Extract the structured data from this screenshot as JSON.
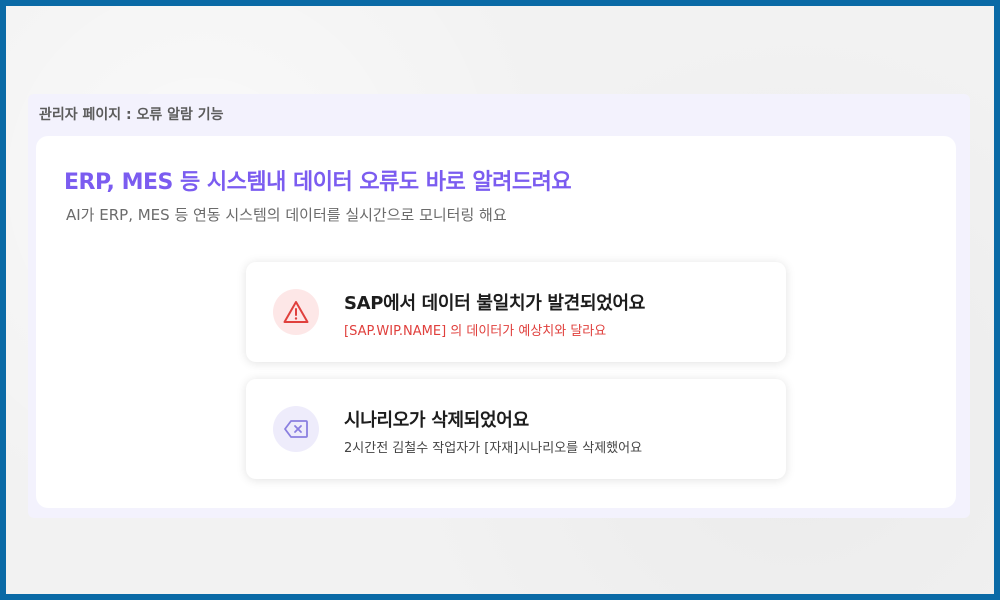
{
  "panel": {
    "title": "관리자 페이지 : 오류 알람 기능"
  },
  "card": {
    "headline": "ERP, MES 등 시스템내 데이터 오류도 바로 알려드려요",
    "subline": "AI가 ERP, MES 등 연동 시스템의 데이터를 실시간으로 모니터링 해요"
  },
  "alerts": [
    {
      "icon": "warning-triangle-icon",
      "title": "SAP에서 데이터 불일치가 발견되었어요",
      "description": "[SAP.WIP.NAME] 의 데이터가 예상치와 달라요",
      "accent_color": "#e0403d",
      "icon_bg": "#fde7e7"
    },
    {
      "icon": "backspace-delete-icon",
      "title": "시나리오가 삭제되었어요",
      "description": "2시간전 김철수 작업자가 [자재]시나리오를 삭제했어요",
      "accent_color": "#8a7fe0",
      "icon_bg": "#eeecfb"
    }
  ],
  "colors": {
    "frame_border": "#0a6aa6",
    "headline": "#7b5cf0",
    "panel_bg": "#f3f2fd"
  }
}
